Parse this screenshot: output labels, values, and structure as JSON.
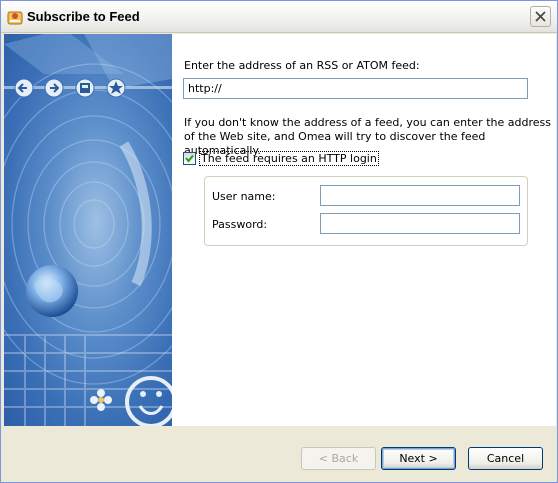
{
  "window": {
    "title": "Subscribe to Feed"
  },
  "banner": {
    "toolbar_icons": [
      "back-arrow-icon",
      "forward-arrow-icon",
      "save-icon",
      "star-icon"
    ]
  },
  "form": {
    "address_label": "Enter the address of an RSS or ATOM feed:",
    "address_value": "http://",
    "help_text": "If you don't know the address of a feed, you can enter the address of the Web site, and Omea will try to discover the feed automatically.",
    "login_checkbox_label": "The feed requires an HTTP login",
    "login_checked": true,
    "username_label": "User name:",
    "username_value": "",
    "password_label": "Password:",
    "password_value": ""
  },
  "buttons": {
    "back": "< Back",
    "next": "Next >",
    "cancel": "Cancel"
  },
  "colors": {
    "banner_blue": "#3a6fb6",
    "border_blue": "#003c74"
  }
}
